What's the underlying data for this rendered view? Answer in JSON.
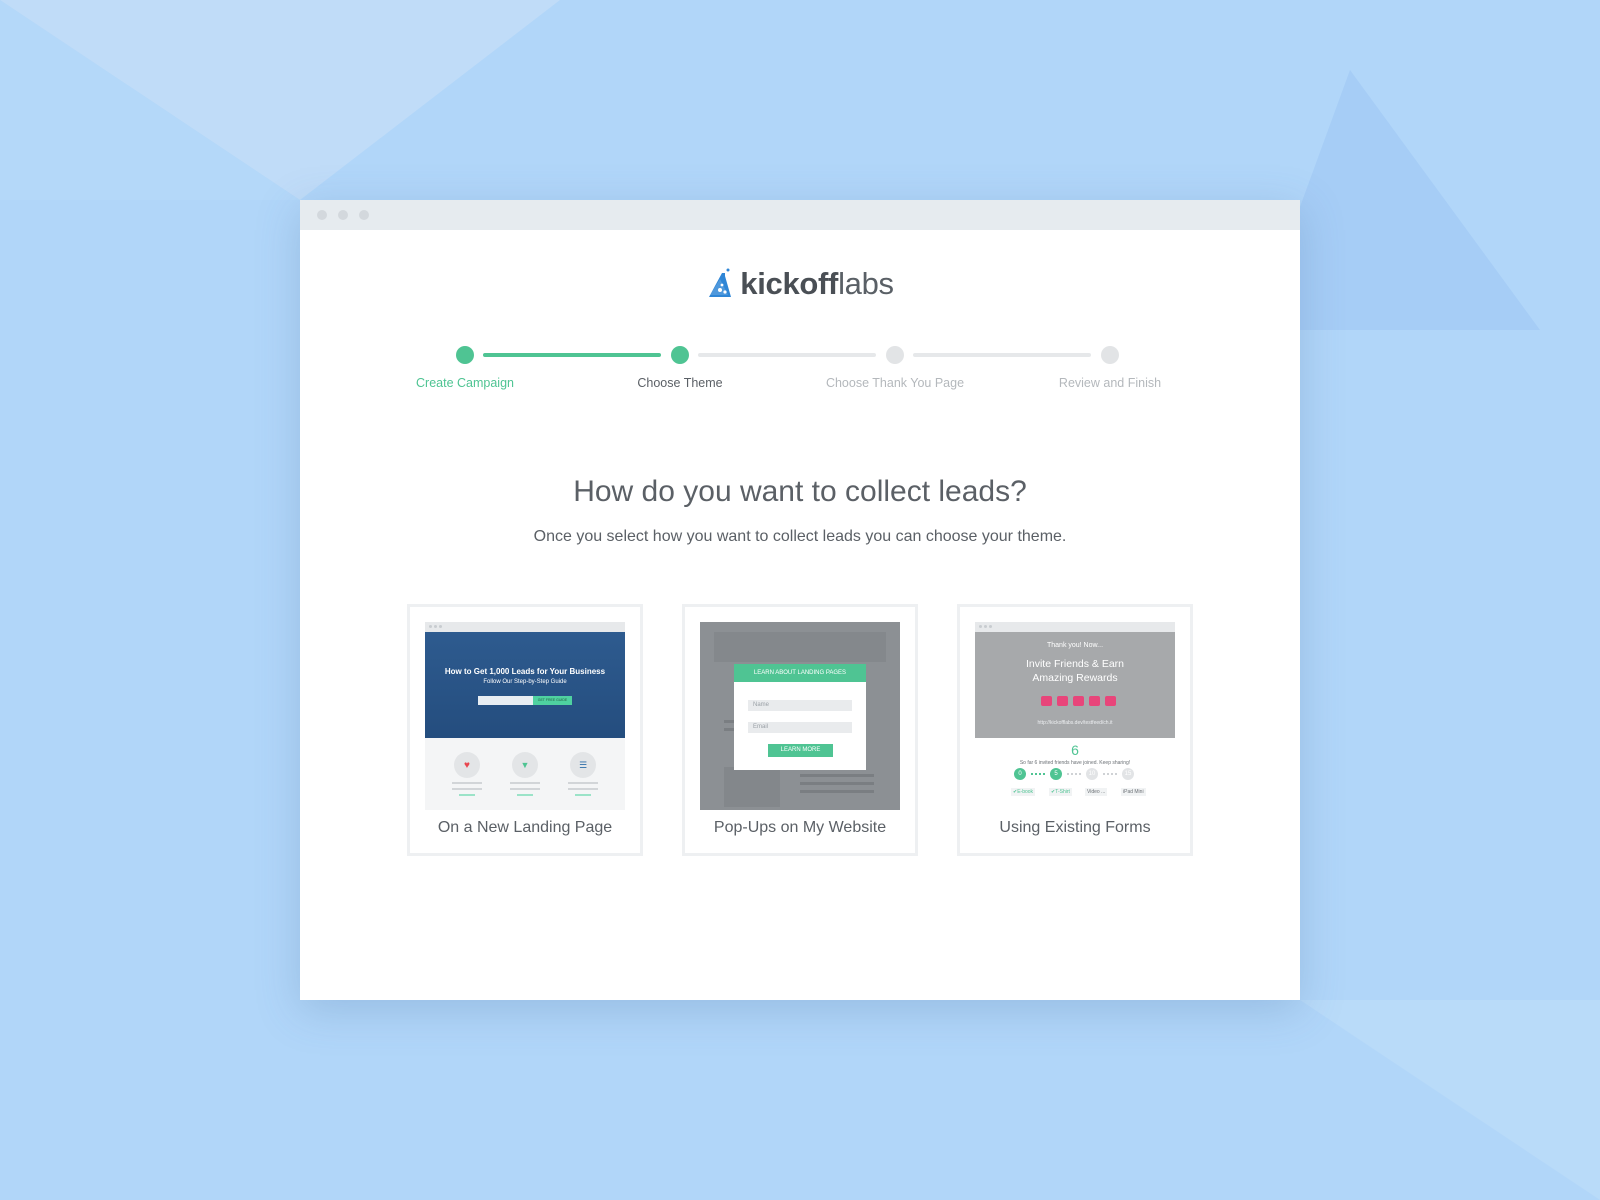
{
  "logo": {
    "brand_bold": "kickoff",
    "brand_light": "labs",
    "icon": "flask-icon"
  },
  "steps": [
    {
      "label": "Create Campaign",
      "state": "complete"
    },
    {
      "label": "Choose Theme",
      "state": "current"
    },
    {
      "label": "Choose Thank You Page",
      "state": "upcoming"
    },
    {
      "label": "Review and Finish",
      "state": "upcoming"
    }
  ],
  "heading": "How do you want to collect leads?",
  "subheading": "Once you select how you want to collect leads you can choose your theme.",
  "options": [
    {
      "label": "On a New Landing Page",
      "preview": {
        "title": "How to Get 1,000 Leads for Your Business",
        "subtitle": "Follow Our Step-by-Step Guide",
        "button": "GET FREE GUIDE"
      }
    },
    {
      "label": "Pop-Ups on My Website",
      "preview": {
        "header": "LEARN ABOUT LANDING PAGES",
        "name_placeholder": "Name",
        "email_placeholder": "Email",
        "button": "LEARN MORE"
      }
    },
    {
      "label": "Using Existing Forms",
      "preview": {
        "kicker": "Thank you! Now...",
        "title_line1": "Invite Friends & Earn",
        "title_line2": "Amazing Rewards",
        "link": "http://kickofflabs.dev/testfeed/ch.it",
        "count": "6",
        "progress_text": "So far 6 invited friends have joined. Keep sharing!",
        "milestones": [
          "0",
          "5",
          "10",
          "15"
        ],
        "rewards": [
          "✔E-book",
          "✔T-Shirt",
          "Video ...",
          "iPad Mini"
        ]
      }
    }
  ],
  "colors": {
    "accent": "#4fc493",
    "text": "#5b6066",
    "muted": "#b4b8bc",
    "background": "#b1d6f9"
  }
}
